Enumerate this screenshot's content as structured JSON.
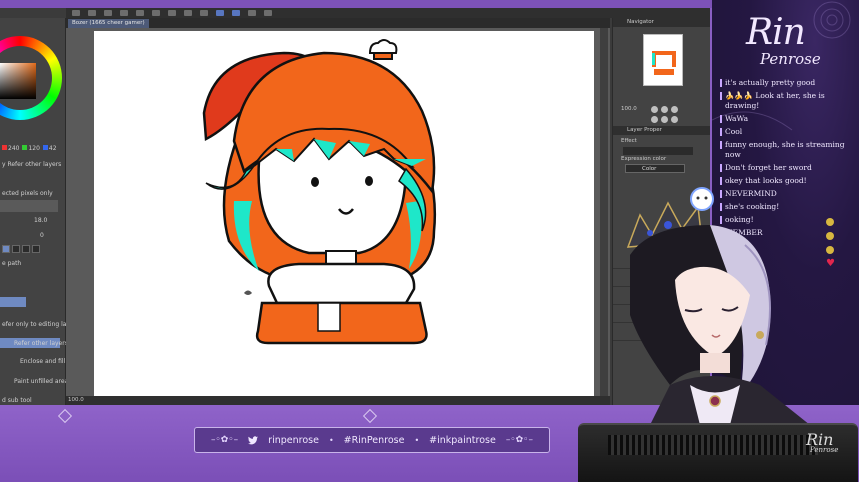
{
  "app": {
    "tab_label": "Bozer (1665 cheer gamer)",
    "zoom_value": "100.0",
    "status_zoom": "100.0",
    "navigator_label": "Navigator",
    "layer_property_label": "Layer Proper",
    "effect_label": "Effect",
    "expression_color_label": "Expression color",
    "color_option": "Color",
    "left_panel": {
      "rgb_r": "240",
      "rgb_g": "120",
      "rgb_b": "42",
      "refer_other_layers": "y Refer other layers",
      "selected_pixels_only": "ected pixels only",
      "value1": "18.0",
      "value2": "0",
      "path_label": "e path",
      "refer_editing_layer": "efer only to editing layer",
      "refer_other_layers_btn": "Refer other layers",
      "enclose_fill": "Enclose and fill",
      "paint_unfilled": "Paint unfilled area",
      "sub_tool": "d sub tool"
    }
  },
  "overlay": {
    "logo_title": "Rin",
    "logo_subtitle": "Penrose",
    "chat": [
      "it's actually pretty good",
      "🍌🍌🍌 Look at her, she is drawing!",
      "WaWa",
      "Cool",
      "funny enough, she is streaming now",
      "Don't forget her sword",
      "okey that looks good!",
      "NEVERMIND",
      "she's cooking!",
      "ooking!",
      "MEMBER",
      "it"
    ]
  },
  "social": {
    "handle": "rinpenrose",
    "hashtag1": "#RinPenrose",
    "hashtag2": "#inkpaintrose"
  },
  "watermark": {
    "title": "Rin",
    "subtitle": "Penrose"
  },
  "colors": {
    "frame_purple": "#8a5fc4",
    "chat_bg": "#241742",
    "accent_lavender": "#c9a7ff",
    "hair_orange": "#f2661b",
    "hair_teal": "#1ee7c9",
    "hat_red": "#e03a1c"
  }
}
